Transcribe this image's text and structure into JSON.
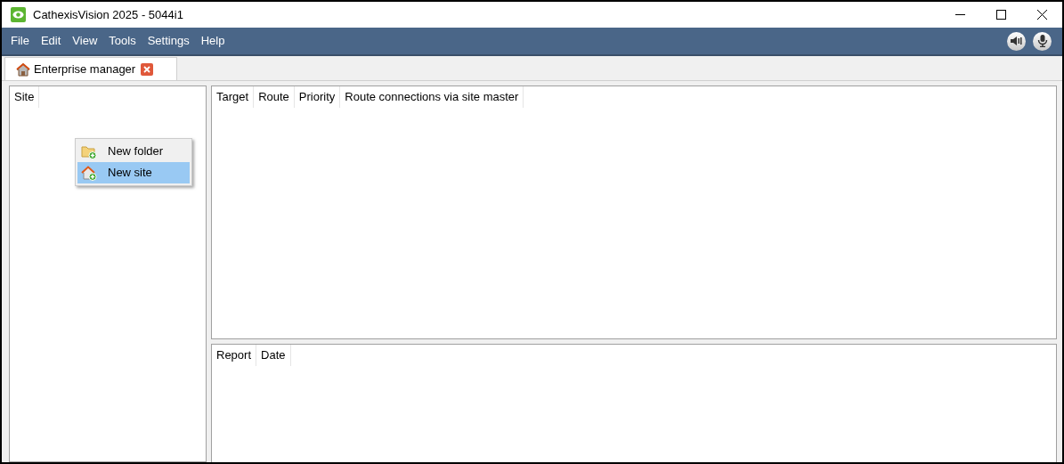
{
  "window": {
    "title": "CathexisVision 2025 - 5044i1"
  },
  "menu_bar": {
    "items": [
      "File",
      "Edit",
      "View",
      "Tools",
      "Settings",
      "Help"
    ]
  },
  "tabs": [
    {
      "label": "Enterprise manager",
      "selected": true
    }
  ],
  "site_tree": {
    "columns": [
      "Site"
    ]
  },
  "context_menu": {
    "items": [
      {
        "label": "New folder",
        "kind": "folder",
        "selected": false
      },
      {
        "label": "New site",
        "kind": "site",
        "selected": true
      }
    ]
  },
  "routes_table": {
    "columns": [
      "Target",
      "Route",
      "Priority",
      "Route connections via site master"
    ]
  },
  "reports_table": {
    "columns": [
      "Report",
      "Date"
    ]
  }
}
